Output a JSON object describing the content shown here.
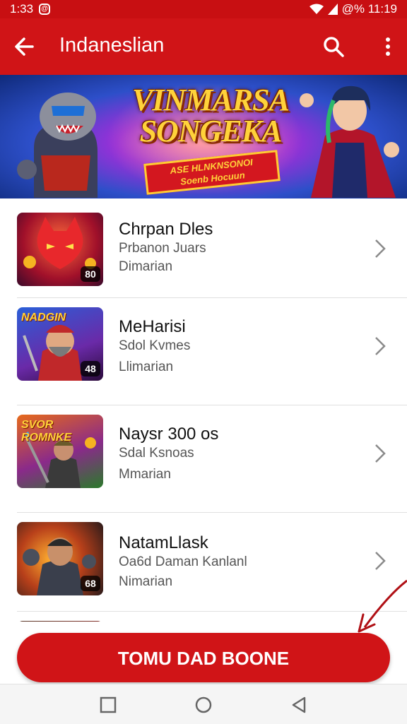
{
  "status": {
    "time": "1:33",
    "right_text": "@% 11:19"
  },
  "app_bar": {
    "title": "Indaneslian"
  },
  "banner": {
    "title_line1": "VINMARSA",
    "title_line2": "SONGEKA",
    "sub_line1": "ASE HLNKNSONOI",
    "sub_line2": "Soenb Hocuun"
  },
  "games": [
    {
      "title": "Chrpan Dles",
      "subtitle": "Prbanon Juars",
      "meta": "Dimarian",
      "badge": "80",
      "label": ""
    },
    {
      "title": "MeHarisi",
      "subtitle": "Sdol Kvmes",
      "meta": "Llimarian",
      "badge": "48",
      "label": "NADGIN"
    },
    {
      "title": "Naysr 300  os",
      "subtitle": "Sdal Ksnoas",
      "meta": "Mmarian",
      "badge": "",
      "label": "SVOR ROMNKE"
    },
    {
      "title": "NatamLlask",
      "subtitle": "Oa6d Daman Kanlanl",
      "meta": "Nimarian",
      "badge": "68",
      "label": ""
    }
  ],
  "cta": {
    "label": "TOMU DAD BOONE"
  },
  "colors": {
    "primary": "#d01417",
    "status": "#c80f12"
  },
  "icons": [
    "back-arrow-icon",
    "search-icon",
    "more-vert-icon",
    "chevron-right-icon",
    "square-nav-icon",
    "circle-nav-icon",
    "triangle-back-nav-icon"
  ]
}
